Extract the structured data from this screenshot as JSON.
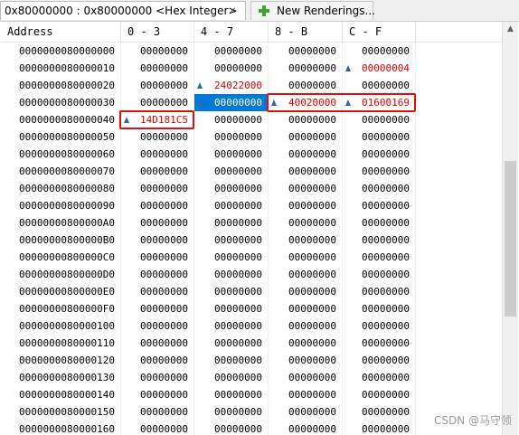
{
  "tabs": [
    {
      "label": "0x80000000 : 0x80000000 <Hex Integer>",
      "close_glyph": "✕"
    },
    {
      "label": "New Renderings...",
      "icon": "plus-icon"
    }
  ],
  "columns": [
    "Address",
    "0 - 3",
    "4 - 7",
    "8 - B",
    "C - F"
  ],
  "rows": [
    {
      "addr": "0000000080000000",
      "cells": [
        "00000000",
        "00000000",
        "00000000",
        "00000000"
      ]
    },
    {
      "addr": "0000000080000010",
      "cells": [
        "00000000",
        "00000000",
        "00000000",
        "00000004"
      ]
    },
    {
      "addr": "0000000080000020",
      "cells": [
        "00000000",
        "24022000",
        "00000000",
        "00000000"
      ]
    },
    {
      "addr": "0000000080000030",
      "cells": [
        "00000000",
        "00000000",
        "40020000",
        "01600169"
      ]
    },
    {
      "addr": "0000000080000040",
      "cells": [
        "14D181C5",
        "00000000",
        "00000000",
        "00000000"
      ]
    },
    {
      "addr": "0000000080000050",
      "cells": [
        "00000000",
        "00000000",
        "00000000",
        "00000000"
      ]
    },
    {
      "addr": "0000000080000060",
      "cells": [
        "00000000",
        "00000000",
        "00000000",
        "00000000"
      ]
    },
    {
      "addr": "0000000080000070",
      "cells": [
        "00000000",
        "00000000",
        "00000000",
        "00000000"
      ]
    },
    {
      "addr": "0000000080000080",
      "cells": [
        "00000000",
        "00000000",
        "00000000",
        "00000000"
      ]
    },
    {
      "addr": "0000000080000090",
      "cells": [
        "00000000",
        "00000000",
        "00000000",
        "00000000"
      ]
    },
    {
      "addr": "00000000800000A0",
      "cells": [
        "00000000",
        "00000000",
        "00000000",
        "00000000"
      ]
    },
    {
      "addr": "00000000800000B0",
      "cells": [
        "00000000",
        "00000000",
        "00000000",
        "00000000"
      ]
    },
    {
      "addr": "00000000800000C0",
      "cells": [
        "00000000",
        "00000000",
        "00000000",
        "00000000"
      ]
    },
    {
      "addr": "00000000800000D0",
      "cells": [
        "00000000",
        "00000000",
        "00000000",
        "00000000"
      ]
    },
    {
      "addr": "00000000800000E0",
      "cells": [
        "00000000",
        "00000000",
        "00000000",
        "00000000"
      ]
    },
    {
      "addr": "00000000800000F0",
      "cells": [
        "00000000",
        "00000000",
        "00000000",
        "00000000"
      ]
    },
    {
      "addr": "0000000080000100",
      "cells": [
        "00000000",
        "00000000",
        "00000000",
        "00000000"
      ]
    },
    {
      "addr": "0000000080000110",
      "cells": [
        "00000000",
        "00000000",
        "00000000",
        "00000000"
      ]
    },
    {
      "addr": "0000000080000120",
      "cells": [
        "00000000",
        "00000000",
        "00000000",
        "00000000"
      ]
    },
    {
      "addr": "0000000080000130",
      "cells": [
        "00000000",
        "00000000",
        "00000000",
        "00000000"
      ]
    },
    {
      "addr": "0000000080000140",
      "cells": [
        "00000000",
        "00000000",
        "00000000",
        "00000000"
      ]
    },
    {
      "addr": "0000000080000150",
      "cells": [
        "00000000",
        "00000000",
        "00000000",
        "00000000"
      ]
    },
    {
      "addr": "0000000080000160",
      "cells": [
        "00000000",
        "00000000",
        "00000000",
        "00000000"
      ]
    }
  ],
  "changed_cells": [
    [
      1,
      3
    ],
    [
      2,
      1
    ],
    [
      3,
      2
    ],
    [
      3,
      3
    ],
    [
      4,
      0
    ]
  ],
  "selected_cell": [
    3,
    1
  ],
  "highlighted_groups": [
    [
      [
        3,
        2
      ],
      [
        3,
        3
      ]
    ],
    [
      [
        4,
        0
      ]
    ]
  ],
  "colors": {
    "changed": "#e00000",
    "selected": "#0078d7",
    "highlight_box": "#e01010",
    "delta_icon": "#2f66a6"
  },
  "watermark": "CSDN @马守领"
}
